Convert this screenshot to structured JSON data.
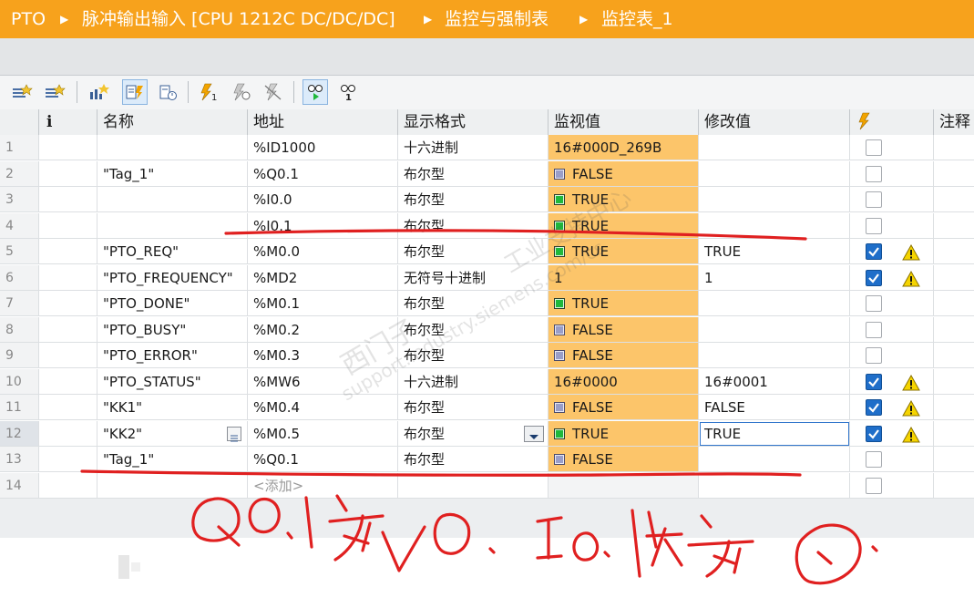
{
  "breadcrumb": {
    "items": [
      "PTO",
      "脉冲输出输入 [CPU 1212C DC/DC/DC]",
      "监控与强制表",
      "监控表_1"
    ]
  },
  "toolbar": {
    "icons": [
      "insert-row-icon",
      "add-row-icon",
      "update-values-icon",
      "show-all-modify-icon",
      "show-monitor-icon",
      "modify-now-icon",
      "modify-trigger-icon",
      "disable-periphery-icon",
      "monitor-all-icon",
      "monitor-once-icon"
    ]
  },
  "table": {
    "headers": [
      "名称",
      "地址",
      "显示格式",
      "监视值",
      "修改值",
      "注释"
    ],
    "rows": [
      {
        "num": "1",
        "name": "",
        "address": "%ID1000",
        "format": "十六进制",
        "monitor": "16#000D_269B",
        "mstate": "",
        "modify": "",
        "checked": false,
        "warn": false
      },
      {
        "num": "2",
        "name": "\"Tag_1\"",
        "address": "%Q0.1",
        "format": "布尔型",
        "monitor": "FALSE",
        "mstate": "f",
        "modify": "",
        "checked": false,
        "warn": false
      },
      {
        "num": "3",
        "name": "",
        "address": "%I0.0",
        "format": "布尔型",
        "monitor": "TRUE",
        "mstate": "t",
        "modify": "",
        "checked": false,
        "warn": false
      },
      {
        "num": "4",
        "name": "",
        "address": "%I0.1",
        "format": "布尔型",
        "monitor": "TRUE",
        "mstate": "t",
        "modify": "",
        "checked": false,
        "warn": false
      },
      {
        "num": "5",
        "name": "\"PTO_REQ\"",
        "address": "%M0.0",
        "format": "布尔型",
        "monitor": "TRUE",
        "mstate": "t",
        "modify": "TRUE",
        "checked": true,
        "warn": true
      },
      {
        "num": "6",
        "name": "\"PTO_FREQUENCY\"",
        "address": "%MD2",
        "format": "无符号十进制",
        "monitor": "1",
        "mstate": "",
        "modify": "1",
        "checked": true,
        "warn": true
      },
      {
        "num": "7",
        "name": "\"PTO_DONE\"",
        "address": "%M0.1",
        "format": "布尔型",
        "monitor": "TRUE",
        "mstate": "t",
        "modify": "",
        "checked": false,
        "warn": false
      },
      {
        "num": "8",
        "name": "\"PTO_BUSY\"",
        "address": "%M0.2",
        "format": "布尔型",
        "monitor": "FALSE",
        "mstate": "f",
        "modify": "",
        "checked": false,
        "warn": false
      },
      {
        "num": "9",
        "name": "\"PTO_ERROR\"",
        "address": "%M0.3",
        "format": "布尔型",
        "monitor": "FALSE",
        "mstate": "f",
        "modify": "",
        "checked": false,
        "warn": false
      },
      {
        "num": "10",
        "name": "\"PTO_STATUS\"",
        "address": "%MW6",
        "format": "十六进制",
        "monitor": "16#0000",
        "mstate": "",
        "modify": "16#0001",
        "checked": true,
        "warn": true
      },
      {
        "num": "11",
        "name": "\"KK1\"",
        "address": "%M0.4",
        "format": "布尔型",
        "monitor": "FALSE",
        "mstate": "f",
        "modify": "FALSE",
        "checked": true,
        "warn": true
      },
      {
        "num": "12",
        "name": "\"KK2\"",
        "address": "%M0.5",
        "format": "布尔型",
        "monitor": "TRUE",
        "mstate": "t",
        "modify": "TRUE",
        "checked": true,
        "warn": true
      },
      {
        "num": "13",
        "name": "\"Tag_1\"",
        "address": "%Q0.1",
        "format": "布尔型",
        "monitor": "FALSE",
        "mstate": "f",
        "modify": "",
        "checked": false,
        "warn": false
      },
      {
        "num": "14",
        "name": "",
        "address": "<添加>",
        "format": "",
        "monitor": "",
        "mstate": "",
        "modify": "",
        "checked": false,
        "warn": false
      }
    ]
  },
  "watermark": [
    "西门子",
    "support.industry.siemens.com/cs",
    "工业支持中心"
  ],
  "annotation": {
    "handwritten": "Q0.1为0. I0.1仍为0.",
    "ink_color": "#e02020"
  }
}
